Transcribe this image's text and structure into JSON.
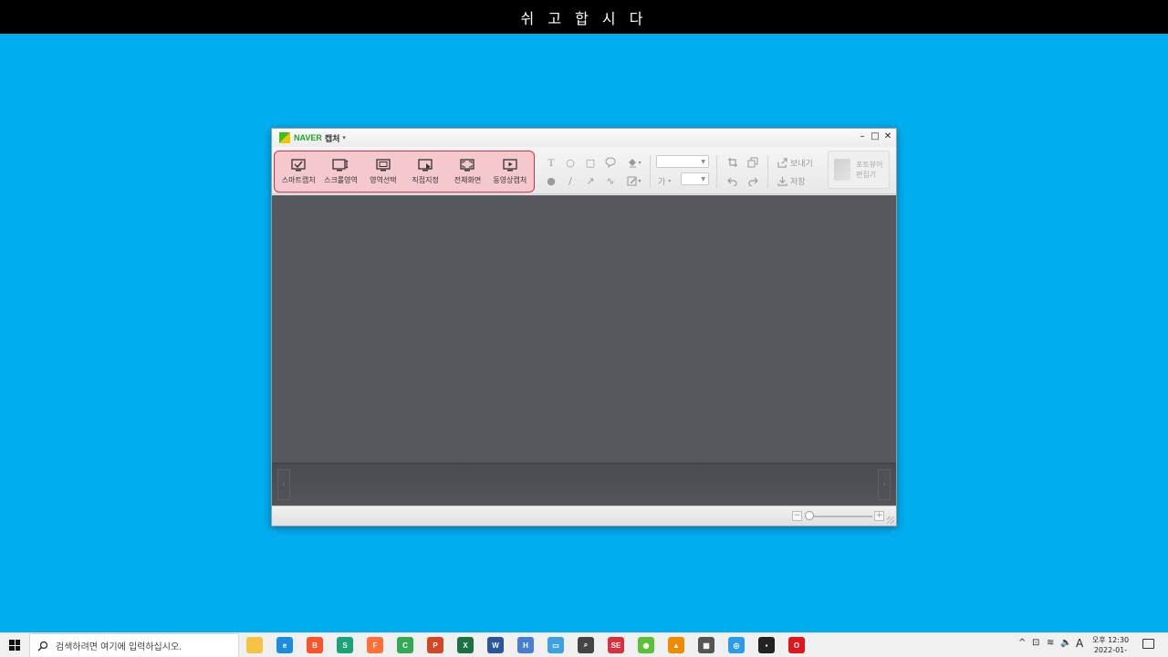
{
  "banner": {
    "text": "쉬 고 합 시 다"
  },
  "window": {
    "brand": "NAVER",
    "brand_sub": "캡처",
    "brand_caret": "▾",
    "controls": {
      "minimize": "–",
      "maximize": "□",
      "close": "✕"
    },
    "capture_modes": [
      {
        "label": "스마트캡처",
        "icon": "smart-capture-icon"
      },
      {
        "label": "스크롤영역",
        "icon": "scroll-capture-icon"
      },
      {
        "label": "영역선택",
        "icon": "region-select-icon"
      },
      {
        "label": "직접지정",
        "icon": "direct-select-icon"
      },
      {
        "label": "전체화면",
        "icon": "fullscreen-icon"
      },
      {
        "label": "동영상캡처",
        "icon": "video-capture-icon"
      }
    ],
    "draw_tools_row1": [
      "T",
      "○",
      "□",
      "💬"
    ],
    "draw_tools_row2": [
      "●",
      "/",
      "↗",
      "∿"
    ],
    "font_size_prefix": "가",
    "send_label": "보내기",
    "save_label": "저장",
    "photo_editor_label_1": "포토뷰어",
    "photo_editor_label_2": "편집기",
    "zoom_minus": "−",
    "zoom_plus": "+",
    "zoom_level": 0.0,
    "thumb_prev": "‹",
    "thumb_next": "›"
  },
  "taskbar": {
    "search_placeholder": "검색하려면 여기에 입력하십시오.",
    "ime": "A",
    "clock_period": "오후 12:30",
    "clock_date": "2022-01-23",
    "tray_caret": "^",
    "apps": [
      {
        "name": "file-explorer",
        "color": "#f5c242",
        "glyph": ""
      },
      {
        "name": "edge",
        "color": "#1b8de0",
        "glyph": "e"
      },
      {
        "name": "brave",
        "color": "#fb542b",
        "glyph": "B"
      },
      {
        "name": "app-green",
        "color": "#1aa37a",
        "glyph": "S"
      },
      {
        "name": "firefox",
        "color": "#ff7139",
        "glyph": "F"
      },
      {
        "name": "chrome",
        "color": "#34a853",
        "glyph": "C"
      },
      {
        "name": "powerpoint",
        "color": "#d24726",
        "glyph": "P"
      },
      {
        "name": "excel",
        "color": "#1d7044",
        "glyph": "X"
      },
      {
        "name": "word",
        "color": "#2b579a",
        "glyph": "W"
      },
      {
        "name": "hangul",
        "color": "#4a7fd0",
        "glyph": "H"
      },
      {
        "name": "remote",
        "color": "#3da0e0",
        "glyph": "▭"
      },
      {
        "name": "search-app",
        "color": "#444444",
        "glyph": "⌕"
      },
      {
        "name": "se-app",
        "color": "#d9303e",
        "glyph": "SE"
      },
      {
        "name": "app-green2",
        "color": "#5bbf3a",
        "glyph": "◉"
      },
      {
        "name": "vlc",
        "color": "#f08a00",
        "glyph": "▲"
      },
      {
        "name": "calculator",
        "color": "#555555",
        "glyph": "▦"
      },
      {
        "name": "chrome-2",
        "color": "#2a9be8",
        "glyph": "◎"
      },
      {
        "name": "sticky",
        "color": "#222222",
        "glyph": "▪"
      },
      {
        "name": "opera",
        "color": "#e0161e",
        "glyph": "O"
      }
    ]
  }
}
